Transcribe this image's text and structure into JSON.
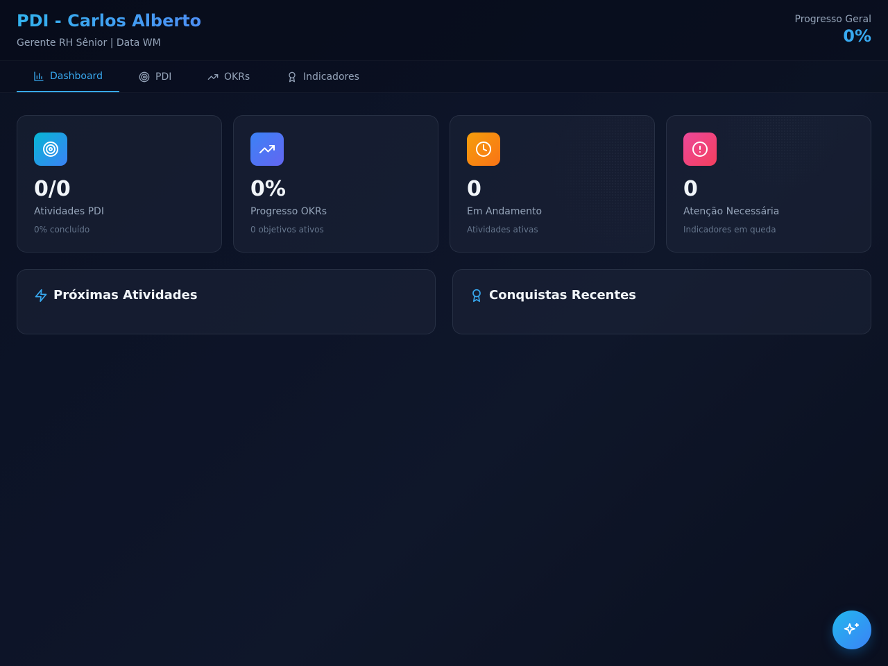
{
  "header": {
    "title": "PDI - Carlos Alberto",
    "subtitle": "Gerente RH Sênior | Data WM",
    "progress_label": "Progresso Geral",
    "progress_value": "0%"
  },
  "nav": {
    "tabs": [
      {
        "label": "Dashboard",
        "icon": "bar-chart-icon",
        "active": true
      },
      {
        "label": "PDI",
        "icon": "target-icon",
        "active": false
      },
      {
        "label": "OKRs",
        "icon": "trending-up-icon",
        "active": false
      },
      {
        "label": "Indicadores",
        "icon": "award-icon",
        "active": false
      }
    ]
  },
  "stats": [
    {
      "value": "0/0",
      "label": "Atividades PDI",
      "sub": "0% concluído",
      "icon": "target-icon",
      "color": "#06b6d4"
    },
    {
      "value": "0%",
      "label": "Progresso OKRs",
      "sub": "0 objetivos ativos",
      "icon": "trending-up-icon",
      "color": "#3b82f6"
    },
    {
      "value": "0",
      "label": "Em Andamento",
      "sub": "Atividades ativas",
      "icon": "clock-icon",
      "color": "#f59e0b"
    },
    {
      "value": "0",
      "label": "Atenção Necessária",
      "sub": "Indicadores em queda",
      "icon": "alert-circle-icon",
      "color": "#ec4899"
    }
  ],
  "panels": {
    "upcoming": {
      "title": "Próximas Atividades",
      "icon": "zap-icon"
    },
    "achievements": {
      "title": "Conquistas Recentes",
      "icon": "award-icon"
    }
  },
  "fab": {
    "icon": "sparkles-icon"
  },
  "colors": {
    "accent": "#38a9f0",
    "background": "#0b1122"
  }
}
